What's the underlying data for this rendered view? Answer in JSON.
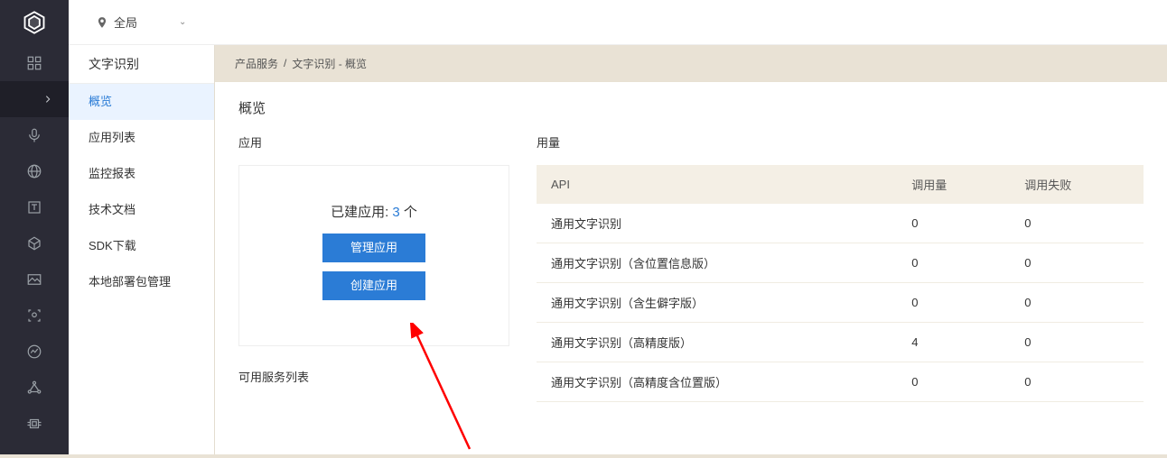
{
  "topbar": {
    "scope_label": "全局"
  },
  "sidebar": {
    "title": "文字识别",
    "items": [
      "概览",
      "应用列表",
      "监控报表",
      "技术文档",
      "SDK下载",
      "本地部署包管理"
    ],
    "active_index": 0
  },
  "breadcrumbs": {
    "a": "产品服务",
    "sep": "/",
    "b": "文字识别 - 概览"
  },
  "panel": {
    "title": "概览",
    "app_section_title": "应用",
    "usage_section_title": "用量",
    "app_box": {
      "prefix": "已建应用:",
      "count": "3",
      "suffix": "个",
      "manage_label": "管理应用",
      "create_label": "创建应用"
    },
    "usage": {
      "headers": [
        "API",
        "调用量",
        "调用失败"
      ],
      "rows": [
        {
          "api": "通用文字识别",
          "calls": "0",
          "fail": "0"
        },
        {
          "api": "通用文字识别（含位置信息版）",
          "calls": "0",
          "fail": "0"
        },
        {
          "api": "通用文字识别（含生僻字版）",
          "calls": "0",
          "fail": "0"
        },
        {
          "api": "通用文字识别（高精度版）",
          "calls": "4",
          "fail": "0"
        },
        {
          "api": "通用文字识别（高精度含位置版）",
          "calls": "0",
          "fail": "0"
        }
      ]
    },
    "services_title": "可用服务列表"
  },
  "colors": {
    "accent": "#2b7cd6",
    "rail_bg": "#2b2b36",
    "page_bg": "#e9e2d5"
  }
}
